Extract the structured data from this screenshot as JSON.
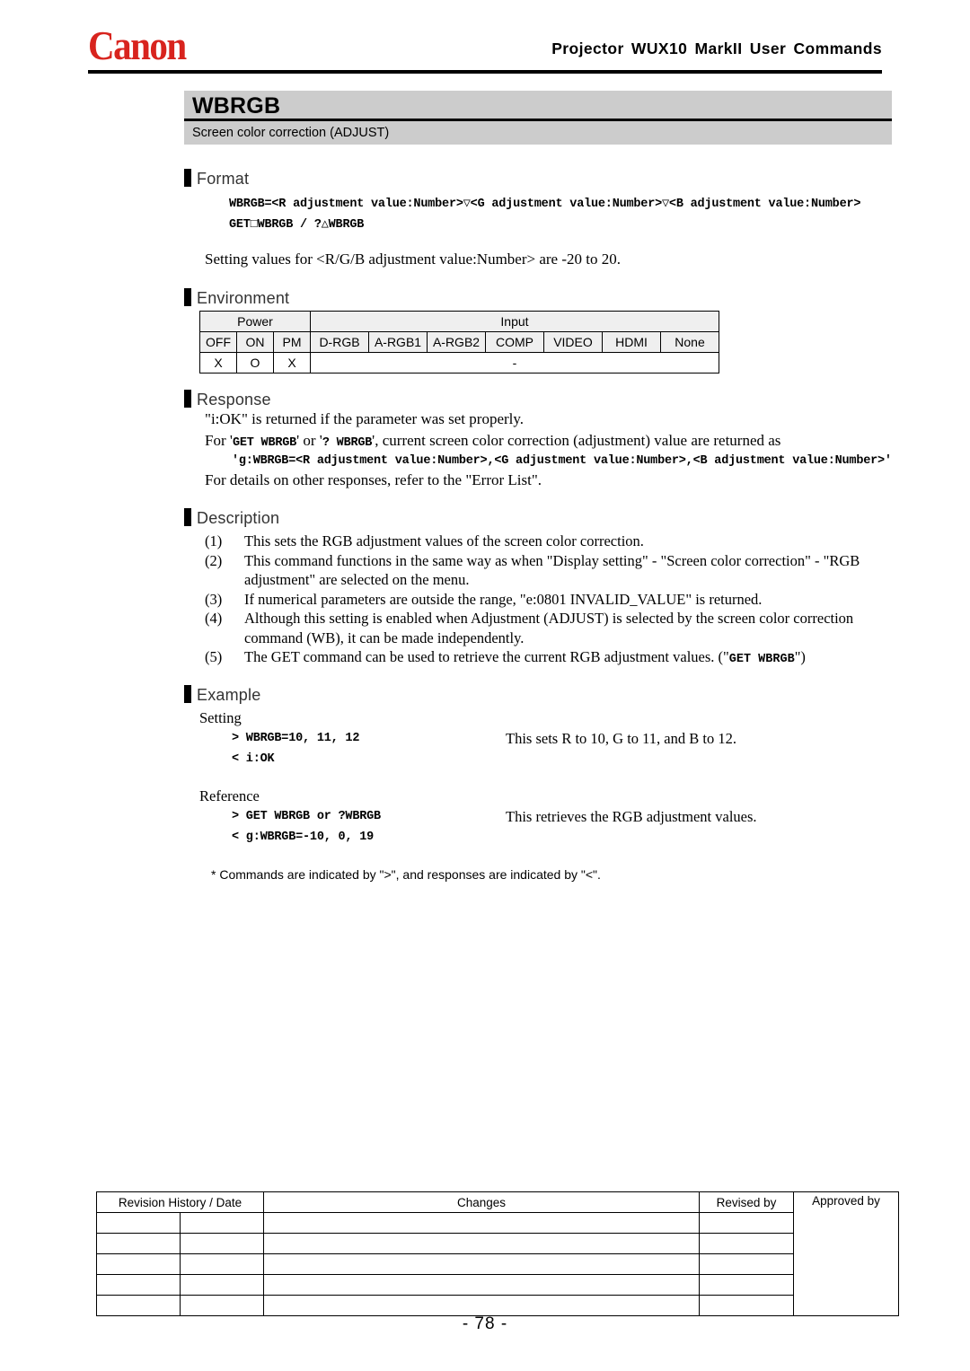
{
  "header": {
    "logo_text": "Canon",
    "logo_color": "#d8241e",
    "title": "Projector WUX10 MarkII User Commands"
  },
  "command": {
    "name": "WBRGB",
    "subtitle": "Screen color correction (ADJUST)"
  },
  "sections": {
    "format": {
      "heading": "Format",
      "lines": [
        "WBRGB=<R adjustment value:Number>▽<G adjustment value:Number>▽<B adjustment value:Number>",
        "GET□WBRGB  /  ?△WBRGB"
      ],
      "note": "Setting values for <R/G/B adjustment value:Number> are -20 to 20."
    },
    "environment": {
      "heading": "Environment",
      "group_headers": [
        "Power",
        "Input"
      ],
      "power_columns": [
        "OFF",
        "ON",
        "PM"
      ],
      "input_columns": [
        "D-RGB",
        "A-RGB1",
        "A-RGB2",
        "COMP",
        "VIDEO",
        "HDMI",
        "None"
      ],
      "power_values": [
        "X",
        "O",
        "X"
      ],
      "input_value": "-"
    },
    "response": {
      "heading": "Response",
      "line1": "\"i:OK\" is returned if the parameter was set properly.",
      "line2_pre": "For '",
      "line2_code1": "GET WBRGB",
      "line2_mid": "' or '",
      "line2_code2": "? WBRGB",
      "line2_post": "', current screen color correction (adjustment) value are returned as",
      "line3_code": "'g:WBRGB=<R adjustment value:Number>,<G adjustment value:Number>,<B adjustment value:Number>'",
      "line4": "For details on other responses, refer to the \"Error List\"."
    },
    "description": {
      "heading": "Description",
      "items": [
        {
          "num": "(1)",
          "text": "This sets the RGB adjustment values of the screen color correction.",
          "code_suffix": ""
        },
        {
          "num": "(2)",
          "text": "This command functions in the same way as when \"Display setting\" - \"Screen color correction\" - \"RGB adjustment\" are selected on the menu.",
          "code_suffix": ""
        },
        {
          "num": "(3)",
          "text": "If numerical parameters are outside the range, \"e:0801 INVALID_VALUE\" is returned.",
          "code_suffix": ""
        },
        {
          "num": "(4)",
          "text": "Although this setting is enabled when Adjustment (ADJUST) is selected by the screen color correction command (WB), it can be made independently.",
          "code_suffix": ""
        },
        {
          "num": "(5)",
          "text": "The GET command can be used to retrieve the current RGB adjustment values. (\"",
          "code_suffix": "GET WBRGB",
          "text_after": "\")"
        }
      ]
    },
    "example": {
      "heading": "Example",
      "setting_label": "Setting",
      "setting_command": "> WBRGB=10, 11, 12",
      "setting_response": "< i:OK",
      "setting_note": "This sets R to 10, G to 11, and B to 12.",
      "reference_label": "Reference",
      "reference_command": "> GET WBRGB or ?WBRGB",
      "reference_response": "< g:WBRGB=-10, 0, 19",
      "reference_note": "This retrieves the RGB adjustment values.",
      "footnote": "* Commands are indicated by \">\", and responses are indicated by \"<\"."
    }
  },
  "revision_table": {
    "headers": [
      "Revision History / Date",
      "Changes",
      "Revised by",
      "Approved by"
    ],
    "rows": [
      [
        "",
        "",
        "",
        ""
      ],
      [
        "",
        "",
        "",
        ""
      ],
      [
        "",
        "",
        "",
        ""
      ],
      [
        "",
        "",
        "",
        ""
      ],
      [
        "",
        "",
        "",
        ""
      ]
    ]
  },
  "page_number": "- 78 -"
}
